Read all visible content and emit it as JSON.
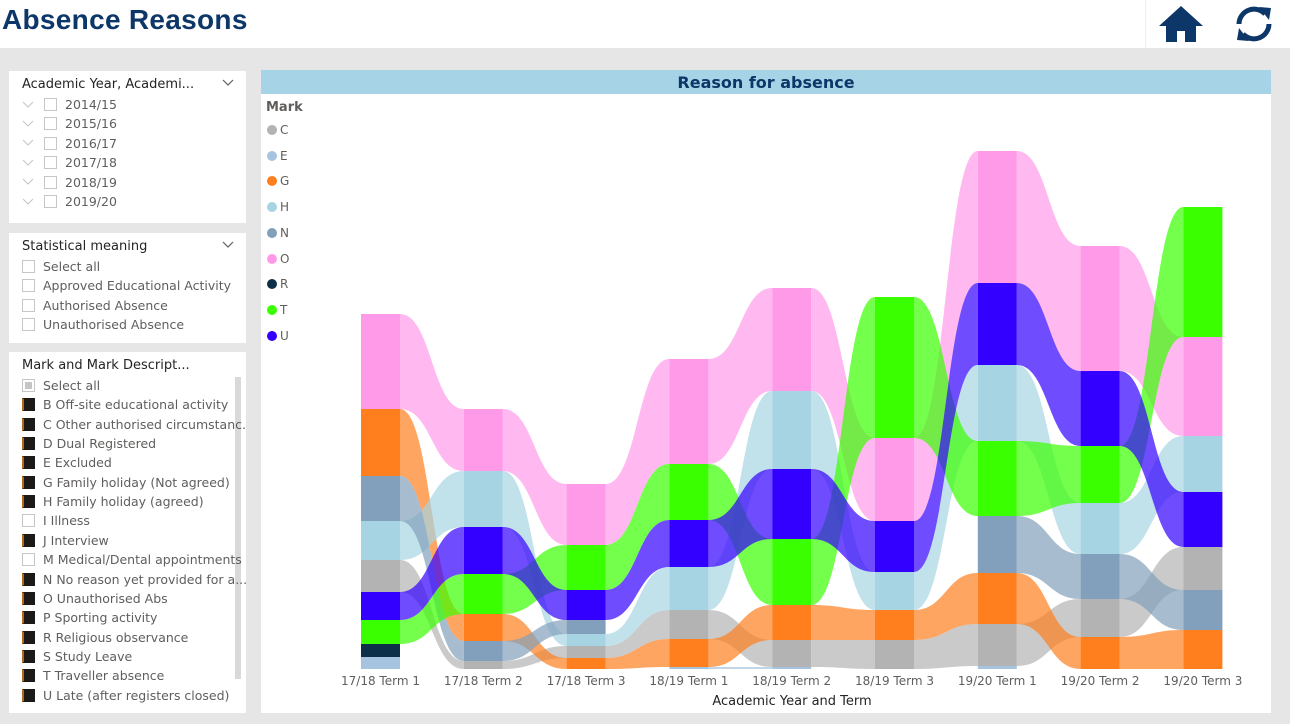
{
  "header": {
    "title": "Absence Reasons",
    "home_icon": "home-icon",
    "refresh_icon": "refresh-icon"
  },
  "slicers": {
    "academic_year": {
      "title": "Academic Year, Academi...",
      "items": [
        "2014/15",
        "2015/16",
        "2016/17",
        "2017/18",
        "2018/19",
        "2019/20"
      ]
    },
    "statistical_meaning": {
      "title": "Statistical meaning",
      "items": [
        {
          "label": "Select all",
          "checked": false
        },
        {
          "label": "Approved Educational Activity",
          "checked": false
        },
        {
          "label": "Authorised Absence",
          "checked": false
        },
        {
          "label": "Unauthorised Absence",
          "checked": false
        }
      ]
    },
    "mark": {
      "title": "Mark and Mark Descript...",
      "items": [
        {
          "label": "Select all",
          "state": "partial"
        },
        {
          "label": "B Off-site educational activity",
          "state": "on"
        },
        {
          "label": "C Other authorised circumstanc...",
          "state": "on"
        },
        {
          "label": "D Dual Registered",
          "state": "on"
        },
        {
          "label": "E Excluded",
          "state": "on"
        },
        {
          "label": "G Family holiday (Not agreed)",
          "state": "on"
        },
        {
          "label": "H Family holiday (agreed)",
          "state": "on"
        },
        {
          "label": "I Illness",
          "state": "off"
        },
        {
          "label": "J Interview",
          "state": "on"
        },
        {
          "label": "M Medical/Dental appointments",
          "state": "off"
        },
        {
          "label": "N No reason yet provided for a...",
          "state": "on"
        },
        {
          "label": "O Unauthorised Abs",
          "state": "on"
        },
        {
          "label": "P Sporting activity",
          "state": "on"
        },
        {
          "label": "R Religious observance",
          "state": "on"
        },
        {
          "label": "S Study Leave",
          "state": "on"
        },
        {
          "label": "T Traveller absence",
          "state": "on"
        },
        {
          "label": "U Late (after registers closed)",
          "state": "on"
        }
      ]
    }
  },
  "chart_data": {
    "type": "ribbon",
    "title": "Reason for absence",
    "xlabel": "Academic Year and Term",
    "ylabel": "",
    "legend_title": "Mark",
    "legend_position": "top-left",
    "categories": [
      "17/18 Term 1",
      "17/18 Term 2",
      "17/18 Term 3",
      "18/19 Term 1",
      "18/19 Term 2",
      "18/19 Term 3",
      "19/20 Term 1",
      "19/20 Term 2",
      "19/20 Term 3"
    ],
    "series": [
      {
        "name": "C",
        "color": "#b3b3b3",
        "values": [
          32,
          8,
          12,
          29,
          27,
          29,
          42,
          38,
          43
        ]
      },
      {
        "name": "E",
        "color": "#a6c4e0",
        "values": [
          12,
          0,
          0,
          2,
          2,
          0,
          3,
          0,
          0
        ]
      },
      {
        "name": "G",
        "color": "#ff7f1f",
        "values": [
          67,
          27,
          11,
          28,
          35,
          30,
          51,
          32,
          39
        ]
      },
      {
        "name": "H",
        "color": "#a6d4e3",
        "values": [
          39,
          56,
          12,
          43,
          78,
          38,
          76,
          51,
          56
        ]
      },
      {
        "name": "N",
        "color": "#829fbb",
        "values": [
          45,
          20,
          14,
          0,
          0,
          0,
          57,
          45,
          40
        ]
      },
      {
        "name": "O",
        "color": "#ff9ae9",
        "values": [
          95,
          62,
          61,
          105,
          103,
          83,
          132,
          125,
          99
        ]
      },
      {
        "name": "R",
        "color": "#0d2f48",
        "values": [
          13,
          0,
          0,
          0,
          0,
          0,
          0,
          0,
          0
        ]
      },
      {
        "name": "T",
        "color": "#39ff00",
        "values": [
          24,
          40,
          45,
          56,
          66,
          141,
          75,
          57,
          130
        ]
      },
      {
        "name": "U",
        "color": "#3300ff",
        "values": [
          28,
          47,
          30,
          47,
          70,
          51,
          82,
          75,
          55
        ]
      }
    ],
    "note": "Ribbon chart: at each category series are stacked ordered by value (largest on top)."
  }
}
